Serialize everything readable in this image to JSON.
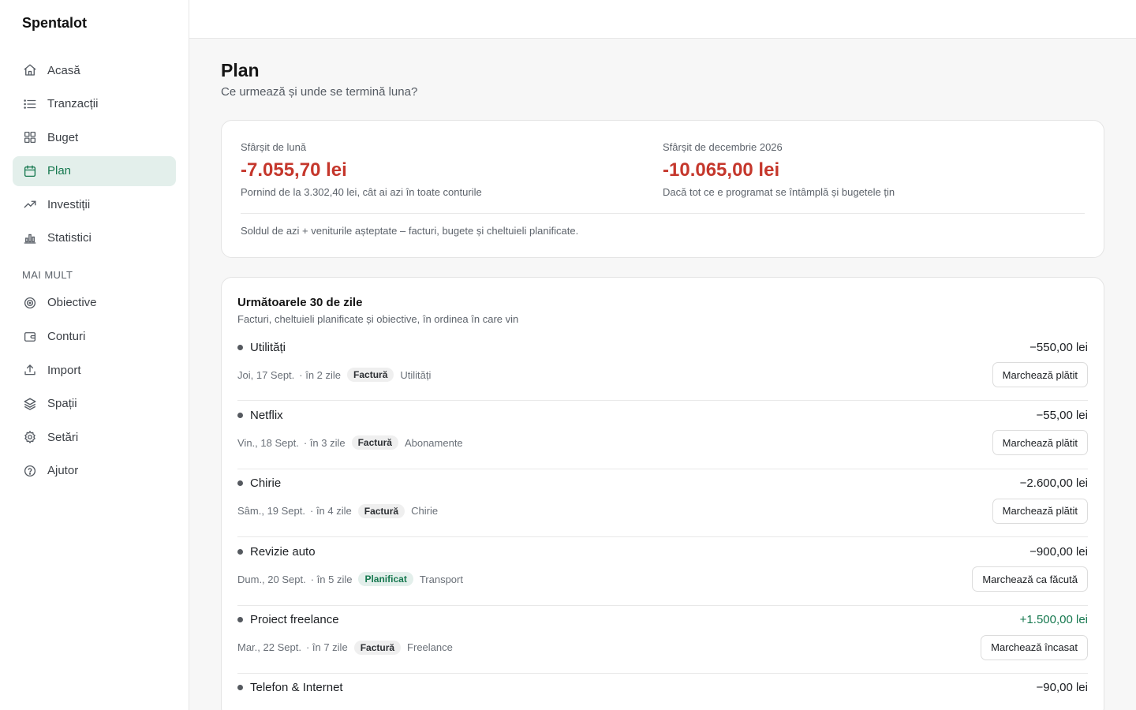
{
  "app": {
    "name": "Spentalot"
  },
  "sidebar": {
    "items": [
      {
        "label": "Acasă",
        "icon": "home-icon"
      },
      {
        "label": "Tranzacții",
        "icon": "list-icon"
      },
      {
        "label": "Buget",
        "icon": "grid-icon"
      },
      {
        "label": "Plan",
        "icon": "calendar-icon",
        "active": true
      },
      {
        "label": "Investiții",
        "icon": "trending-up-icon"
      },
      {
        "label": "Statistici",
        "icon": "bar-chart-icon"
      }
    ],
    "more_label": "MAI MULT",
    "more_items": [
      {
        "label": "Obiective",
        "icon": "target-icon"
      },
      {
        "label": "Conturi",
        "icon": "wallet-icon"
      },
      {
        "label": "Import",
        "icon": "upload-icon"
      },
      {
        "label": "Spații",
        "icon": "layers-icon"
      },
      {
        "label": "Setări",
        "icon": "gear-icon"
      },
      {
        "label": "Ajutor",
        "icon": "help-circle-icon"
      }
    ]
  },
  "page": {
    "title": "Plan",
    "subtitle": "Ce urmează și unde se termină luna?"
  },
  "summary": {
    "month_end": {
      "label": "Sfârșit de lună",
      "value": "-7.055,70 lei",
      "note": "Pornind de la 3.302,40 lei, cât ai azi în toate conturile"
    },
    "year_end": {
      "label": "Sfârșit de decembrie 2026",
      "value": "-10.065,00 lei",
      "note": "Dacă tot ce e programat se întâmplă și bugetele țin"
    },
    "footnote": "Soldul de azi + veniturile așteptate – facturi, bugete și cheltuieli planificate."
  },
  "upcoming": {
    "title": "Următoarele 30 de zile",
    "subtitle": "Facturi, cheltuieli planificate și obiective, în ordinea în care vin",
    "items": [
      {
        "name": "Utilități",
        "amount": "−550,00 lei",
        "date": "Joi, 17 Sept.",
        "relative": "· în 2 zile",
        "tag": "Factură",
        "category": "Utilități",
        "action": "Marchează plătit"
      },
      {
        "name": "Netflix",
        "amount": "−55,00 lei",
        "date": "Vin., 18 Sept.",
        "relative": "· în 3 zile",
        "tag": "Factură",
        "category": "Abonamente",
        "action": "Marchează plătit"
      },
      {
        "name": "Chirie",
        "amount": "−2.600,00 lei",
        "date": "Sâm., 19 Sept.",
        "relative": "· în 4 zile",
        "tag": "Factură",
        "category": "Chirie",
        "action": "Marchează plătit"
      },
      {
        "name": "Revizie auto",
        "amount": "−900,00 lei",
        "date": "Dum., 20 Sept.",
        "relative": "· în 5 zile",
        "tag": "Planificat",
        "category": "Transport",
        "action": "Marchează ca făcută"
      },
      {
        "name": "Proiect freelance",
        "amount": "+1.500,00 lei",
        "date": "Mar., 22 Sept.",
        "relative": "· în 7 zile",
        "tag": "Factură",
        "category": "Freelance",
        "action": "Marchează încasat"
      },
      {
        "name": "Telefon & Internet",
        "amount": "−90,00 lei"
      }
    ]
  },
  "colors": {
    "accent": "#16784f",
    "accent_bg": "#e3efeb",
    "negative": "#c5372c",
    "positive": "#16784f"
  }
}
